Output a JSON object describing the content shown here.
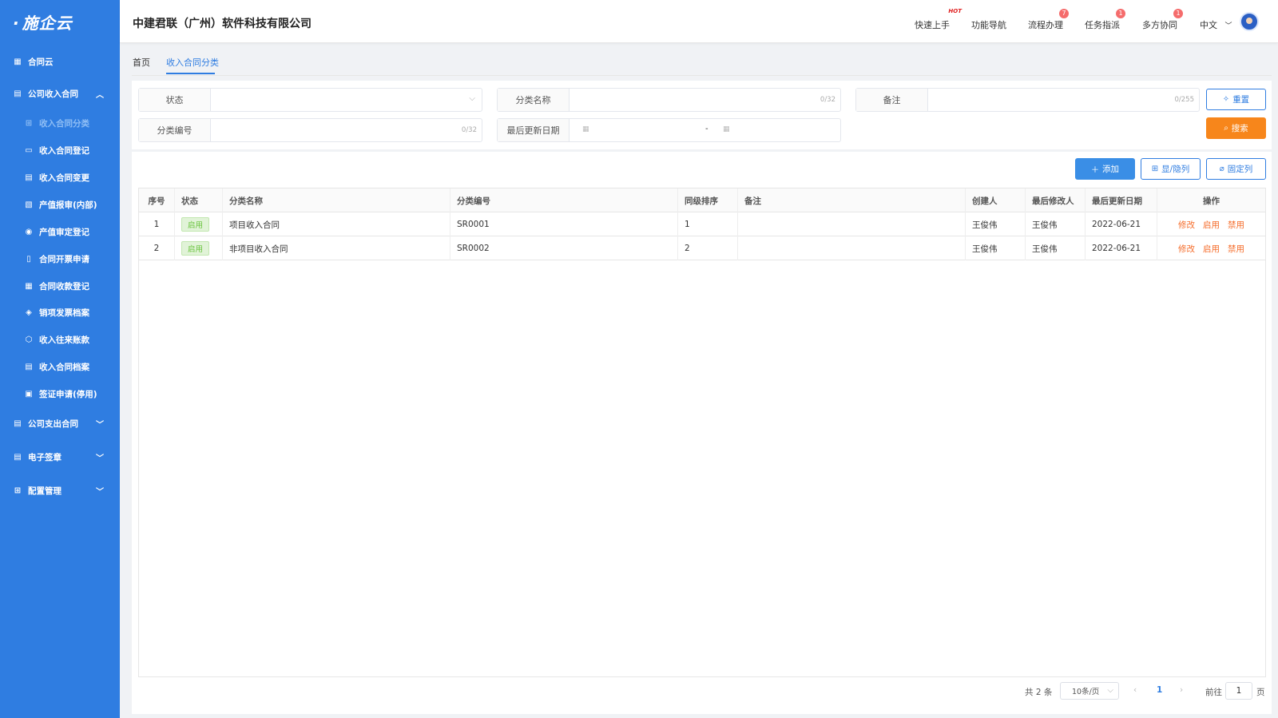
{
  "app": {
    "logo": "施企云",
    "company": "中建君联（广州）软件科技有限公司"
  },
  "sidebar": {
    "top_item": "合同云",
    "groups": [
      {
        "label": "公司收入合同",
        "expanded": true
      },
      {
        "label": "公司支出合同",
        "expanded": false
      },
      {
        "label": "电子签章",
        "expanded": false
      },
      {
        "label": "配置管理",
        "expanded": false
      }
    ],
    "items": [
      {
        "label": "收入合同分类",
        "active": true
      },
      {
        "label": "收入合同登记"
      },
      {
        "label": "收入合同变更"
      },
      {
        "label": "产值报审(内部)"
      },
      {
        "label": "产值审定登记"
      },
      {
        "label": "合同开票申请"
      },
      {
        "label": "合同收款登记"
      },
      {
        "label": "销项发票档案"
      },
      {
        "label": "收入往来账款"
      },
      {
        "label": "收入合同档案"
      },
      {
        "label": "签证申请(停用)"
      }
    ]
  },
  "header": {
    "nav": [
      {
        "label": "快速上手",
        "tag": "HOT"
      },
      {
        "label": "功能导航"
      },
      {
        "label": "流程办理",
        "badge": "7"
      },
      {
        "label": "任务指派",
        "badge": "1"
      },
      {
        "label": "多方协同",
        "badge": "1"
      }
    ],
    "language": "中文"
  },
  "tabs": [
    {
      "label": "首页"
    },
    {
      "label": "收入合同分类",
      "active": true
    }
  ],
  "search": {
    "status_label": "状态",
    "name_label": "分类名称",
    "name_counter": "0/32",
    "remark_label": "备注",
    "remark_counter": "0/255",
    "code_label": "分类编号",
    "code_counter": "0/32",
    "date_label": "最后更新日期",
    "date_sep": "-",
    "reset_label": "重置",
    "search_label": "搜索"
  },
  "toolbar": {
    "add_label": "添加",
    "toggle_cols_label": "显/隐列",
    "fix_cols_label": "固定列"
  },
  "table": {
    "headers": [
      "序号",
      "状态",
      "分类名称",
      "分类编号",
      "同级排序",
      "备注",
      "创建人",
      "最后修改人",
      "最后更新日期",
      "操作"
    ],
    "rows": [
      {
        "idx": "1",
        "status": "启用",
        "name": "项目收入合同",
        "code": "SR0001",
        "order": "1",
        "remark": "",
        "creator": "王俊伟",
        "modifier": "王俊伟",
        "date": "2022-06-21"
      },
      {
        "idx": "2",
        "status": "启用",
        "name": "非项目收入合同",
        "code": "SR0002",
        "order": "2",
        "remark": "",
        "creator": "王俊伟",
        "modifier": "王俊伟",
        "date": "2022-06-21"
      }
    ],
    "actions": [
      "修改",
      "启用",
      "禁用"
    ]
  },
  "pagination": {
    "total": "共 2 条",
    "page_size": "10条/页",
    "current": "1",
    "goto_label": "前往",
    "goto_value": "1",
    "page_suffix": "页"
  },
  "colors": {
    "sidebar": "#2f7de1",
    "accent": "#2f7de1",
    "orange": "#f7861b",
    "danger": "#f56c6c"
  }
}
